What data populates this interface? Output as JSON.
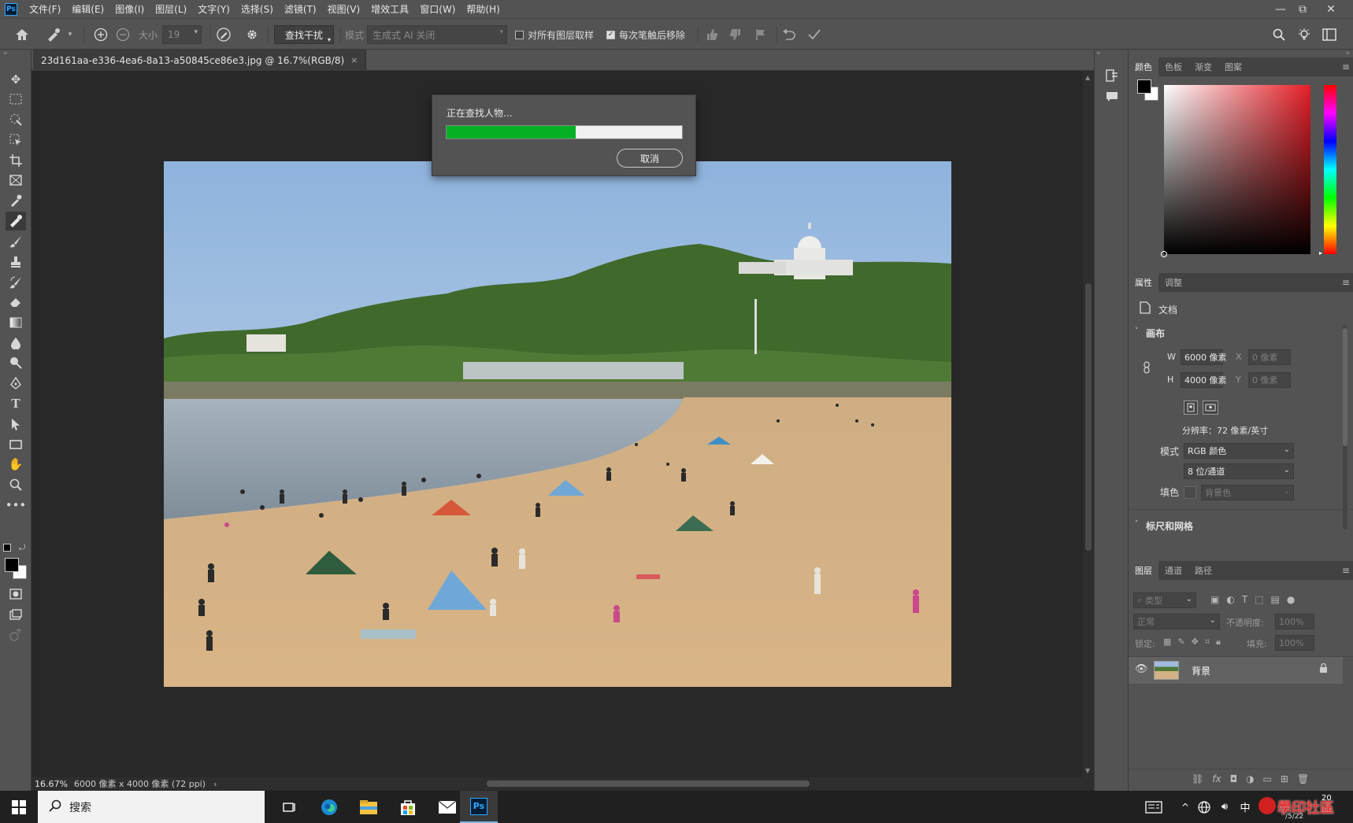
{
  "app": {
    "logo": "Ps",
    "menu": [
      "文件(F)",
      "编辑(E)",
      "图像(I)",
      "图层(L)",
      "文字(Y)",
      "选择(S)",
      "滤镜(T)",
      "视图(V)",
      "增效工具",
      "窗口(W)",
      "帮助(H)"
    ],
    "window_controls": [
      "—",
      "⧉",
      "✕"
    ]
  },
  "options_bar": {
    "size_label": "大小",
    "size_value": "19",
    "find_distractions_label": "查找干扰",
    "mode_label": "模式",
    "mode_value": "生成式 AI 关闭",
    "sample_all_layers_label": "对所有图层取样",
    "sample_all_layers_checked": false,
    "remove_after_stroke_label": "每次笔触后移除",
    "remove_after_stroke_checked": true
  },
  "document": {
    "tab_title": "23d161aa-e336-4ea6-8a13-a50845ce86e3.jpg @ 16.7%(RGB/8)",
    "close_glyph": "×",
    "zoom": "16.67%",
    "status": "6000 像素 x 4000 像素 (72 ppi)",
    "status_arrow": "›"
  },
  "dialog": {
    "message": "正在查找人物...",
    "progress": 0.55,
    "cancel_label": "取消",
    "progress_color": "#06b025"
  },
  "color_panel": {
    "tabs": [
      "颜色",
      "色板",
      "渐变",
      "图案"
    ],
    "active_tab": 0,
    "foreground": "#000000",
    "background": "#ffffff",
    "hue_color": "#e41e26"
  },
  "properties_panel": {
    "tabs": [
      "属性",
      "调整"
    ],
    "active_tab": 0,
    "doc_label": "文档",
    "canvas_header": "画布",
    "w_label": "W",
    "w_value": "6000 像素",
    "h_label": "H",
    "h_value": "4000 像素",
    "x_label": "X",
    "x_value": "0 像素",
    "y_label": "Y",
    "y_value": "0 像素",
    "resolution": "分辨率：72 像素/英寸",
    "mode_label": "模式",
    "mode_value": "RGB 颜色",
    "depth_value": "8 位/通道",
    "fill_label": "填色",
    "fill_value": "背景色",
    "rulers_header": "标尺和网格"
  },
  "layers_panel": {
    "tabs": [
      "图层",
      "通道",
      "路径"
    ],
    "active_tab": 0,
    "kind_placeholder": "类型",
    "blend_mode": "正常",
    "opacity_label": "不透明度:",
    "opacity_value": "100%",
    "lock_label": "锁定:",
    "fill_label": "填充:",
    "fill_value": "100%",
    "layer_name": "背景"
  },
  "taskbar": {
    "search_label": "搜索",
    "ime": "中",
    "watermark": "學印社區",
    "clock_partial": "20",
    "date_partial": "/5/22"
  }
}
